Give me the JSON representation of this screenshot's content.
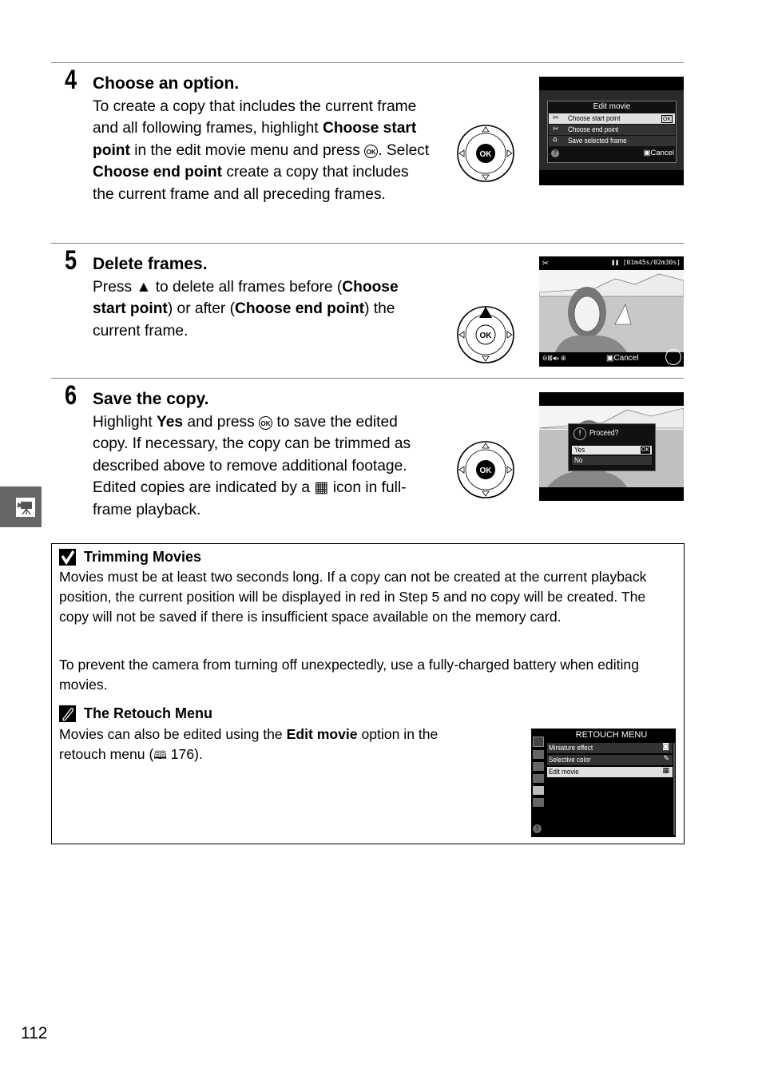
{
  "page_number": "112",
  "side_tab": {
    "icon": "movie-camera-icon"
  },
  "steps": [
    {
      "number": "4",
      "title": "Choose an option.",
      "body": [
        {
          "t": "To create a copy that includes the current frame and all following frames, highlight "
        },
        {
          "b": "Choose start point"
        },
        {
          "t": " in the edit movie menu and press "
        },
        {
          "ok": "OK"
        },
        {
          "t": ". Select "
        },
        {
          "b": "Choose end point"
        },
        {
          "t": " create a copy that includes the current frame and all preceding frames."
        }
      ],
      "dpad": {
        "center": "OK",
        "highlight": "none"
      },
      "screen": {
        "type": "menu",
        "title": "Edit movie",
        "items": [
          {
            "icon": "start-point-icon",
            "label": "Choose start point",
            "badge": "OK",
            "selected": true
          },
          {
            "icon": "end-point-icon",
            "label": "Choose end point",
            "selected": false
          },
          {
            "icon": "save-frame-icon",
            "label": "Save selected frame",
            "selected": false
          }
        ],
        "help": "?",
        "cancel": "Cancel"
      }
    },
    {
      "number": "5",
      "title": "Delete frames.",
      "body": [
        {
          "t": "Press ▲ to delete all frames before ("
        },
        {
          "b": "Choose start point"
        },
        {
          "t": ") or after ("
        },
        {
          "b": "Choose end point"
        },
        {
          "t": ") the current frame."
        }
      ],
      "dpad": {
        "center": "OK",
        "highlight": "up"
      },
      "screen": {
        "type": "playback",
        "mode_icon": "start-point-icon",
        "time": "01m45s/02m30s",
        "cancel": "Cancel"
      }
    },
    {
      "number": "6",
      "title": "Save the copy.",
      "body": [
        {
          "t": "Highlight "
        },
        {
          "b": "Yes"
        },
        {
          "t": " and press "
        },
        {
          "ok": "OK"
        },
        {
          "t": " to save the edited copy.  If necessary, the copy can be trimmed as described above to remove additional footage.  Edited copies are indicated by a "
        },
        {
          "icon": "edited-movie-icon"
        },
        {
          "t": " icon in full-frame playback."
        }
      ],
      "dpad": {
        "center": "OK",
        "highlight": "none"
      },
      "screen": {
        "type": "dialog",
        "title": "Proceed?",
        "options": [
          {
            "label": "Yes",
            "badge": "OK",
            "selected": true
          },
          {
            "label": "No",
            "selected": false
          }
        ]
      }
    }
  ],
  "notes": [
    {
      "icon": "check-icon",
      "title": "Trimming Movies",
      "paragraphs": [
        "Movies must be at least two seconds long. If a copy can not be created at the current playback position, the current position will be displayed in red in Step 5 and no copy will be created.  The copy will not be saved if there is insufficient space available on the memory card.",
        "To prevent the camera from turning off unexpectedly, use a fully-charged battery when editing movies."
      ]
    },
    {
      "icon": "pencil-icon",
      "title": "The Retouch Menu",
      "body_pre": "Movies can also be edited using the ",
      "body_bold": "Edit movie",
      "body_post": " option in the retouch menu (",
      "page_ref": "176",
      "body_end": ").",
      "screen": {
        "title": "RETOUCH MENU",
        "items": [
          {
            "label": "Miniature effect",
            "selected": false
          },
          {
            "label": "Selective color",
            "selected": false
          },
          {
            "label": "Edit movie",
            "selected": true
          }
        ]
      }
    }
  ]
}
